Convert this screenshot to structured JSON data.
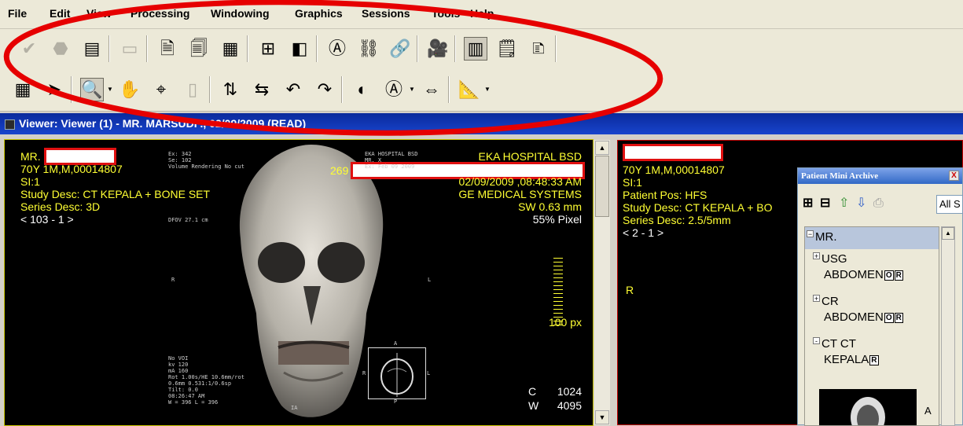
{
  "menu": [
    "File",
    "Edit",
    "View",
    "Processing",
    "Windowing",
    "Graphics",
    "Sessions",
    "Tools",
    "Help"
  ],
  "toolbar1": [
    {
      "name": "checkmark-icon",
      "glyph": "✔",
      "state": "disabled"
    },
    {
      "name": "stop-octagon-icon",
      "glyph": "⬣",
      "state": "disabled"
    },
    {
      "name": "open-window-icon",
      "glyph": "▤",
      "state": "normal"
    },
    {
      "name": "save-disk-icon",
      "glyph": "▭",
      "state": "disabled"
    },
    {
      "name": "document-icon",
      "glyph": "🗎",
      "state": "normal"
    },
    {
      "name": "document-stack-icon",
      "glyph": "🗐",
      "state": "normal"
    },
    {
      "name": "layout-add-icon",
      "glyph": "▦",
      "state": "normal"
    },
    {
      "name": "grid-layout-icon",
      "glyph": "⊞",
      "state": "normal"
    },
    {
      "name": "single-layout-icon",
      "glyph": "◧",
      "state": "normal"
    },
    {
      "name": "annotation-a-icon",
      "glyph": "Ⓐ",
      "state": "normal"
    },
    {
      "name": "link-arrow-icon",
      "glyph": "⛓",
      "state": "normal"
    },
    {
      "name": "link-icon",
      "glyph": "🔗",
      "state": "normal"
    },
    {
      "name": "film-camera-icon",
      "glyph": "🎥",
      "state": "normal"
    },
    {
      "name": "patient-list-icon",
      "glyph": "▥",
      "state": "pressed"
    },
    {
      "name": "report-glasses-icon",
      "glyph": "🗒",
      "state": "normal"
    },
    {
      "name": "sticky-note-icon",
      "glyph": "🗈",
      "state": "normal"
    }
  ],
  "toolbar2": [
    {
      "name": "grid-select-icon",
      "glyph": "▦",
      "state": "normal",
      "dd": false
    },
    {
      "name": "pointer-arrow-icon",
      "glyph": "➤",
      "state": "normal",
      "dd": false
    },
    {
      "name": "zoom-magnifier-icon",
      "glyph": "🔍",
      "state": "pressed",
      "dd": true
    },
    {
      "name": "pan-hand-icon",
      "glyph": "✋",
      "state": "normal",
      "dd": false
    },
    {
      "name": "probe-icon",
      "glyph": "⌖",
      "state": "normal",
      "dd": false
    },
    {
      "name": "flip-disabled-icon",
      "glyph": "▯",
      "state": "disabled",
      "dd": false
    },
    {
      "name": "flip-vertical-icon",
      "glyph": "⇅",
      "state": "normal",
      "dd": false
    },
    {
      "name": "flip-horizontal-icon",
      "glyph": "⇆",
      "state": "normal",
      "dd": false
    },
    {
      "name": "rotate-left-icon",
      "glyph": "↶",
      "state": "normal",
      "dd": false
    },
    {
      "name": "rotate-right-icon",
      "glyph": "↷",
      "state": "normal",
      "dd": false
    },
    {
      "name": "contrast-icon",
      "glyph": "◐",
      "state": "normal",
      "dd": false
    },
    {
      "name": "window-level-icon",
      "glyph": "Ⓐ",
      "state": "normal",
      "dd": true
    },
    {
      "name": "cine-icon",
      "glyph": "⇔",
      "state": "normal",
      "dd": false
    },
    {
      "name": "measure-angle-icon",
      "glyph": "📐",
      "state": "normal",
      "dd": true
    }
  ],
  "viewer_title": "Viewer: Viewer (1) - MR. MARSUDI ., 02/09/2009 (READ)",
  "viewport1": {
    "name_prefix": "MR.",
    "patient_line": "70Y 1M,M,00014807",
    "slice": "SI:1",
    "study_desc": "Study Desc: CT KEPALA + BONE SET",
    "series_desc": "Series Desc: 3D",
    "image_index": "< 103 - 1 >",
    "hospital": "EKA HOSPITAL BSD",
    "date_time": "02/09/2009 ,08:48:33 AM",
    "manufacturer": "GE MEDICAL SYSTEMS",
    "slice_width": "SW 0.63 mm",
    "zoom": "55% Pixel",
    "scale": "100 px",
    "center_label": "C",
    "center_value": "1024",
    "width_label": "W",
    "width_value": "4095",
    "frame_number": "269",
    "burned_tl": [
      "Ex: 342",
      "Se: 102",
      "Volume Rendering  No cut"
    ],
    "burned_tr": [
      "EKA HOSPITAL BSD",
      "MR. X",
      "Ex: Feb 09 2009"
    ],
    "burned_bl": [
      "No VOI",
      "kv 120",
      "mA 160",
      "Rot 1.00s/HE 10.6mm/rot",
      "0.6mm 0.531:1/0.6sp",
      "Tilt: 0.0",
      "08:26:47 AM",
      "W = 396 L = 396"
    ],
    "burned_mid": "DFOV 27.1 cm",
    "orient_r": "R",
    "orient_l": "L",
    "orient_a": "A",
    "orient_p": "P",
    "orient_ia": "IA",
    "scout_r": "R",
    "scout_l": "L"
  },
  "viewport2": {
    "patient_line": "70Y 1M,M,00014807",
    "slice": "SI:1",
    "patient_pos": "Patient Pos: HFS",
    "study_desc": "Study Desc: CT KEPALA + BO",
    "series_desc": "Series Desc: 2.5/5mm",
    "image_index": "< 2 - 1 >",
    "orient_r": "R"
  },
  "archive": {
    "title": "Patient Mini Archive",
    "close": "X",
    "all_label": "All S",
    "patient": "MR.",
    "items": [
      {
        "line1": "USG",
        "line2": "ABDOMEN",
        "badges": [
          "O",
          "R"
        ],
        "expand": "+"
      },
      {
        "line1": "CR",
        "line2": "ABDOMEN",
        "badges": [
          "O",
          "R"
        ],
        "expand": "+"
      },
      {
        "line1": "CT CT",
        "line2": "KEPALA",
        "badges": [
          "R"
        ],
        "expand": "-"
      }
    ],
    "thumb_side": "A"
  }
}
